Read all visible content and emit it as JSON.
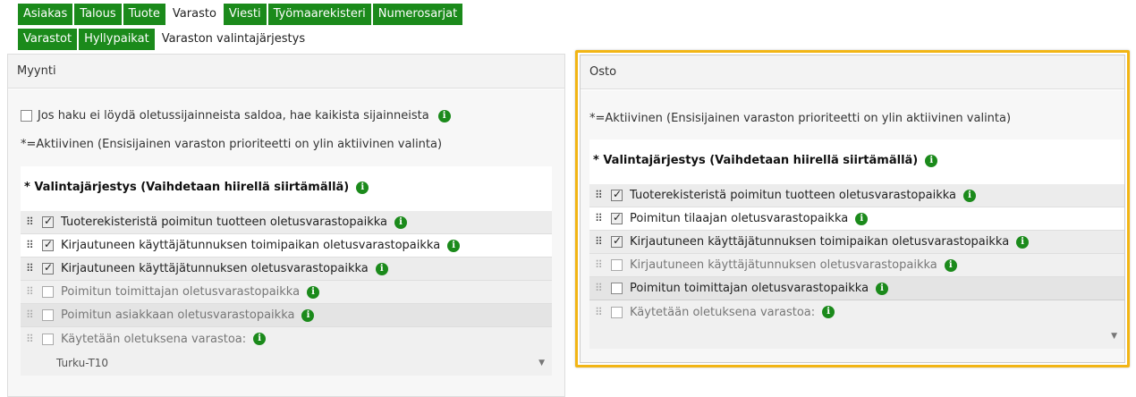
{
  "tabs_top": [
    "Asiakas",
    "Talous",
    "Tuote",
    "Varasto",
    "Viesti",
    "Työmaarekisteri",
    "Numerosarjat"
  ],
  "tabs_sub": [
    "Varastot",
    "Hyllypaikat",
    "Varaston valintajärjestys"
  ],
  "myynti": {
    "title": "Myynti",
    "fallback_label": "Jos haku ei löydä oletussijainneista saldoa, hae kaikista sijainneista",
    "note": "*=Aktiivinen (Ensisijainen varaston prioriteetti on ylin aktiivinen valinta)",
    "section_title": "* Valintajärjestys (Vaihdetaan hiirellä siirtämällä)",
    "rows": [
      {
        "label": "Tuoterekisteristä poimitun tuotteen oletusvarastopaikka",
        "checked": true
      },
      {
        "label": "Kirjautuneen käyttäjätunnuksen toimipaikan oletusvarastopaikka",
        "checked": true
      },
      {
        "label": "Kirjautuneen käyttäjätunnuksen oletusvarastopaikka",
        "checked": true
      },
      {
        "label": "Poimitun toimittajan oletusvarastopaikka",
        "checked": false
      },
      {
        "label": "Poimitun asiakkaan oletusvarastopaikka",
        "checked": false
      },
      {
        "label": "Käytetään oletuksena varastoa:",
        "checked": false
      }
    ],
    "default_warehouse_value": "Turku-T10"
  },
  "osto": {
    "title": "Osto",
    "note": "*=Aktiivinen (Ensisijainen varaston prioriteetti on ylin aktiivinen valinta)",
    "section_title": "* Valintajärjestys (Vaihdetaan hiirellä siirtämällä)",
    "rows": [
      {
        "label": "Tuoterekisteristä poimitun tuotteen oletusvarastopaikka",
        "checked": true
      },
      {
        "label": "Poimitun tilaajan oletusvarastopaikka",
        "checked": true
      },
      {
        "label": "Kirjautuneen käyttäjätunnuksen toimipaikan oletusvarastopaikka",
        "checked": true
      },
      {
        "label": "Kirjautuneen käyttäjätunnuksen oletusvarastopaikka",
        "checked": false
      },
      {
        "label": "Poimitun toimittajan oletusvarastopaikka",
        "checked": false
      },
      {
        "label": "Käytetään oletuksena varastoa:",
        "checked": false
      }
    ],
    "default_warehouse_value": ""
  },
  "icons": {
    "info": "i",
    "drag": "⠿",
    "caret": "▼"
  },
  "colors": {
    "tab_green": "#1b8a1b",
    "highlight": "#f2b515"
  }
}
